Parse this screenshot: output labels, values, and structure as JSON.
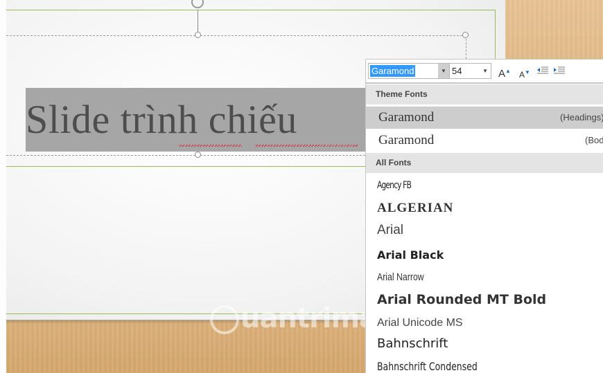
{
  "slide": {
    "title_text": "Slide trình chiếu",
    "title_color": "#4d4d4d",
    "highlight_color": "#a6a6a6",
    "accent_line_color": "#9bbb59"
  },
  "watermark": {
    "text": "uantrimang"
  },
  "mini_toolbar": {
    "font_value": "Garamond",
    "size_value": "54",
    "grow_font_label": "A",
    "shrink_font_label": "A",
    "buttons": [
      "grow-font",
      "shrink-font",
      "decrease-indent",
      "increase-indent"
    ]
  },
  "font_dropdown": {
    "theme_header": "Theme Fonts",
    "theme_fonts": [
      {
        "name": "Garamond",
        "tag": "(Headings)",
        "selected": true
      },
      {
        "name": "Garamond",
        "tag": "(Body)",
        "selected": false
      }
    ],
    "all_header": "All Fonts",
    "all_fonts": [
      "Agency FB",
      "ALGERIAN",
      "Arial",
      "Arial Black",
      "Arial Narrow",
      "Arial Rounded MT Bold",
      "Arial Unicode MS",
      "Bahnschrift",
      "Bahnschrift Condensed"
    ]
  }
}
